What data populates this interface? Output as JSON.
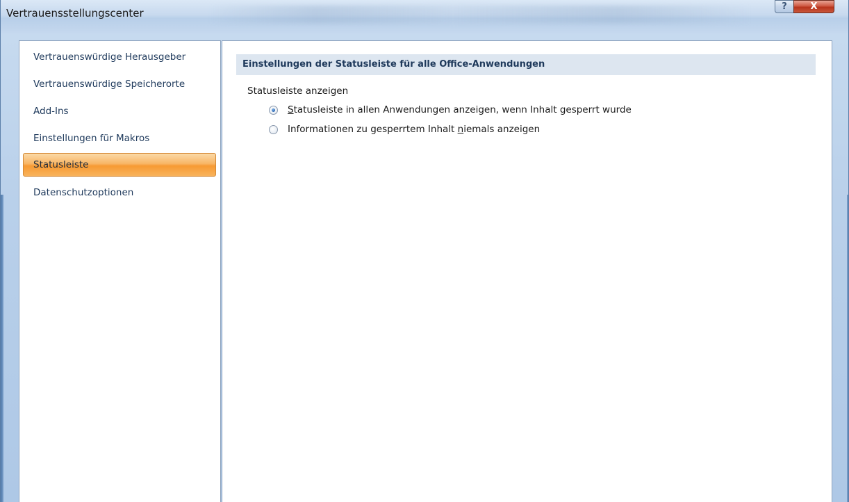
{
  "window": {
    "title": "Vertrauensstellungscenter",
    "help_button": "?",
    "close_button": "X"
  },
  "sidebar": {
    "items": [
      {
        "label": "Vertrauenswürdige Herausgeber",
        "selected": false
      },
      {
        "label": "Vertrauenswürdige Speicherorte",
        "selected": false
      },
      {
        "label": "Add-Ins",
        "selected": false
      },
      {
        "label": "Einstellungen für Makros",
        "selected": false
      },
      {
        "label": "Statusleiste",
        "selected": true
      },
      {
        "label": "Datenschutzoptionen",
        "selected": false
      }
    ]
  },
  "main": {
    "section_title": "Einstellungen der Statusleiste für alle Office-Anwendungen",
    "group_label": "Statusleiste anzeigen",
    "options": [
      {
        "access_key": "S",
        "rest": "tatusleiste in allen Anwendungen anzeigen, wenn Inhalt gesperrt wurde",
        "checked": true
      },
      {
        "prefix": "Informationen zu gesperrtem Inhalt ",
        "access_key": "n",
        "rest": "iemals anzeigen",
        "checked": false
      }
    ]
  },
  "colors": {
    "selection_accent": "#f79a33",
    "header_background": "#dde6f0",
    "header_text": "#1e395b",
    "close_button": "#c9583c"
  },
  "icons": [
    "help-icon",
    "close-icon",
    "radio-checked-icon",
    "radio-unchecked-icon"
  ]
}
